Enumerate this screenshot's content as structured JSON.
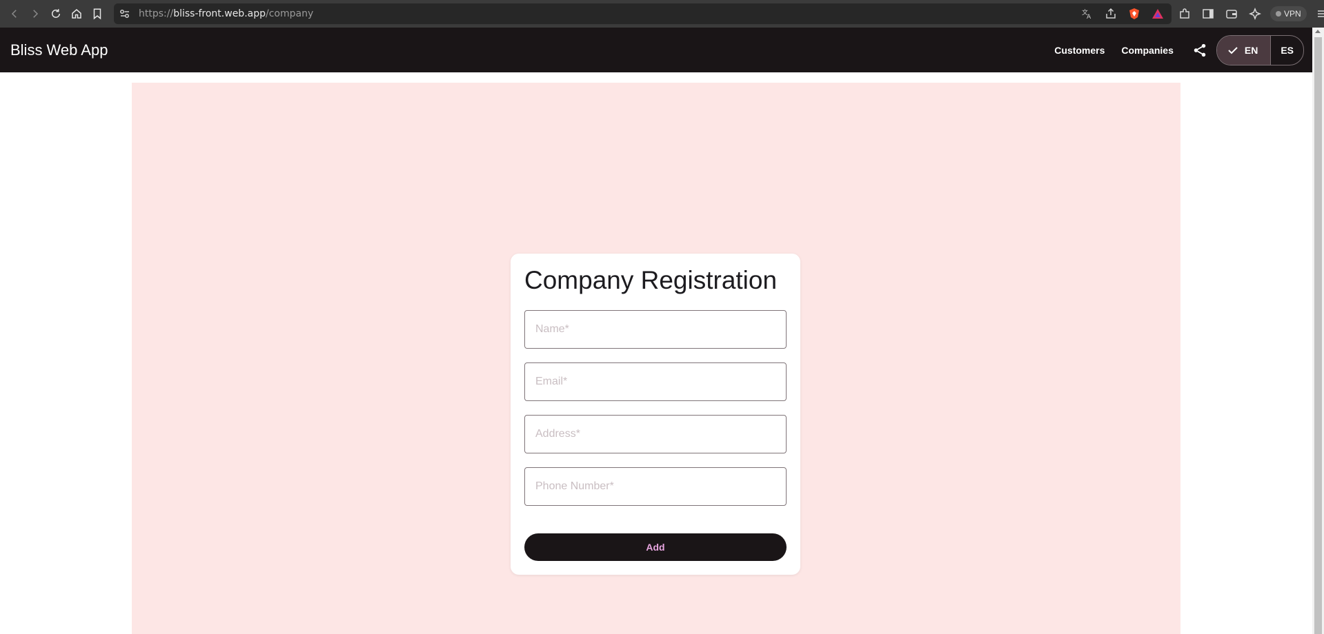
{
  "browser": {
    "url_scheme": "https://",
    "url_host": "bliss-front.web.app",
    "url_path": "/company",
    "vpn_label": "VPN"
  },
  "app": {
    "title": "Bliss Web App",
    "nav": {
      "customers": "Customers",
      "companies": "Companies"
    },
    "language": {
      "options": [
        "EN",
        "ES"
      ],
      "selected": "EN"
    }
  },
  "form": {
    "title": "Company Registration",
    "fields": [
      {
        "placeholder": "Name*",
        "value": ""
      },
      {
        "placeholder": "Email*",
        "value": ""
      },
      {
        "placeholder": "Address*",
        "value": ""
      },
      {
        "placeholder": "Phone Number*",
        "value": ""
      }
    ],
    "submit_label": "Add"
  },
  "colors": {
    "header_bg": "#1a1517",
    "content_bg": "#fde6e5",
    "button_text": "#e8a5e0"
  },
  "icons": {
    "back": "back-arrow-icon",
    "forward": "forward-arrow-icon",
    "reload": "reload-icon",
    "home": "home-icon",
    "bookmark": "bookmark-icon",
    "share": "share-icon",
    "check": "check-icon"
  }
}
